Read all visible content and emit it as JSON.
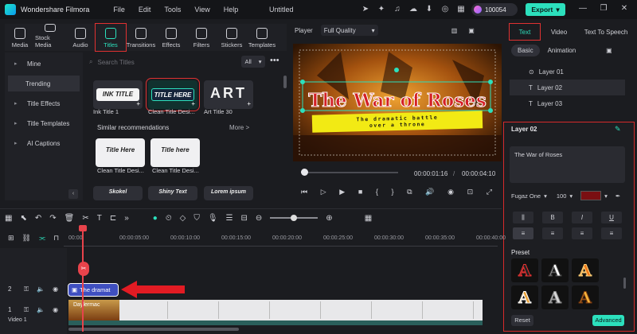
{
  "app": {
    "name": "Wondershare Filmora",
    "document": "Untitled",
    "menu": [
      "File",
      "Edit",
      "Tools",
      "View",
      "Help"
    ],
    "credits": "100054",
    "export": "Export"
  },
  "library": {
    "tabs": [
      {
        "label": "Media",
        "icon": "media-icon"
      },
      {
        "label": "Stock Media",
        "icon": "stock-media-icon"
      },
      {
        "label": "Audio",
        "icon": "audio-icon"
      },
      {
        "label": "Titles",
        "icon": "titles-icon",
        "active": true
      },
      {
        "label": "Transitions",
        "icon": "transitions-icon"
      },
      {
        "label": "Effects",
        "icon": "effects-icon"
      },
      {
        "label": "Filters",
        "icon": "filters-icon"
      },
      {
        "label": "Stickers",
        "icon": "stickers-icon"
      },
      {
        "label": "Templates",
        "icon": "templates-icon"
      }
    ],
    "sidebar": [
      {
        "label": "Mine"
      },
      {
        "label": "Trending",
        "active": true
      },
      {
        "label": "Title Effects"
      },
      {
        "label": "Title Templates"
      },
      {
        "label": "AI Captions"
      }
    ],
    "search_placeholder": "Search Titles",
    "filter": "All",
    "cards": [
      {
        "label": "Ink Title 1",
        "art": "INK TITLE"
      },
      {
        "label": "Clean Title Desi...",
        "art": "TITLE HERE",
        "selected": true
      },
      {
        "label": "Art Title 30",
        "art": "ART"
      }
    ],
    "similar_header": "Similar recommendations",
    "similar_more": "More >",
    "similar": [
      {
        "label": "Clean Title Desi...",
        "art": "Title Here"
      },
      {
        "label": "Clean Title Desi...",
        "art": "Title here"
      }
    ],
    "similar_row3": [
      "Skokel",
      "Shiny Text",
      "Lorem ipsum"
    ]
  },
  "player": {
    "label": "Player",
    "quality": "Full Quality",
    "title": "The War of Roses",
    "subtitle_line1": "The dramatic battle",
    "subtitle_line2": "over a throne",
    "current": "00:00:01:16",
    "separator": "/",
    "total": "00:00:04:10",
    "progress": 0.0
  },
  "right": {
    "tabs": [
      "Text",
      "Video",
      "Text To Speech"
    ],
    "subtabs": [
      "Basic",
      "Animation"
    ],
    "layers": [
      {
        "label": "Layer 01"
      },
      {
        "label": "Layer 02",
        "active": true
      },
      {
        "label": "Layer 03"
      }
    ],
    "panel_title": "Layer 02",
    "text_value": "The War of Roses",
    "font": "Fugaz One",
    "size": "100",
    "color": "#7a0f12",
    "format": [
      "B",
      "I",
      "U"
    ],
    "preset_label": "Preset",
    "reset": "Reset",
    "advanced": "Advanced"
  },
  "timeline": {
    "ticks": [
      "00:00",
      "00:00:05:00",
      "00:00:10:00",
      "00:00:15:00",
      "00:00:20:00",
      "00:00:25:00",
      "00:00:30:00",
      "00:00:35:00",
      "00:00:40:00"
    ],
    "text_clip": "The dramat",
    "video_clip": "Daylermac",
    "track2": "2",
    "track1": "1",
    "video_label": "Video 1"
  }
}
